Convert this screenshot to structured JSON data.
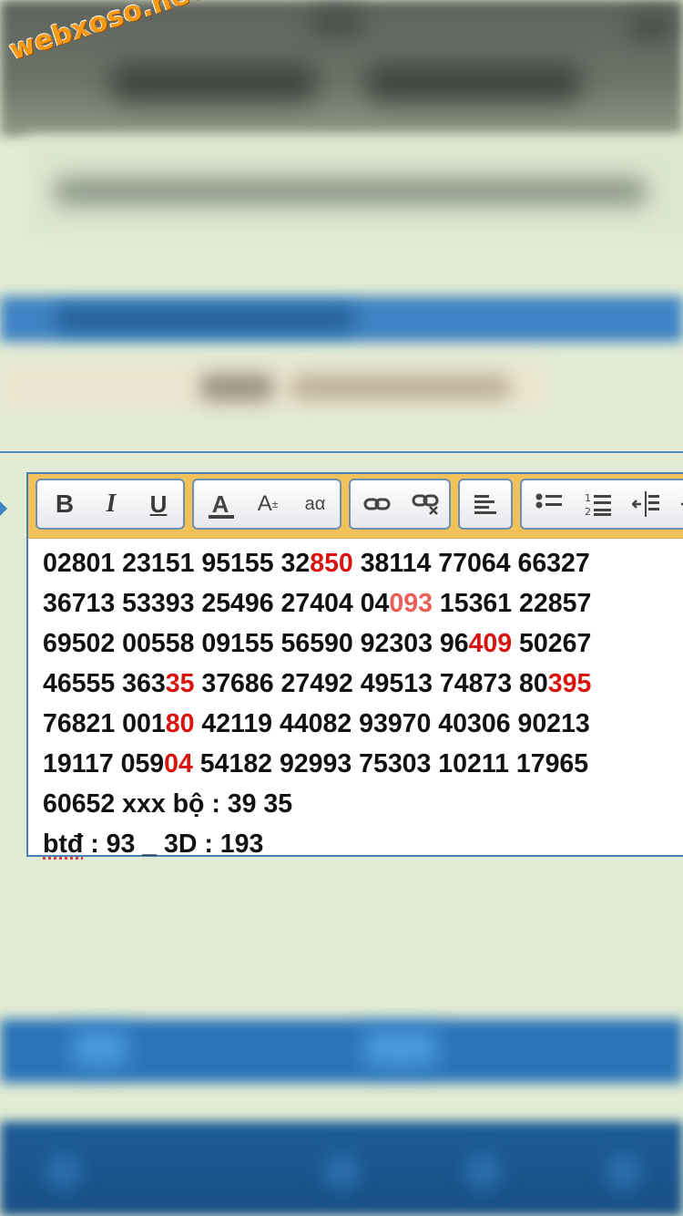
{
  "watermark": "webxoso.net",
  "toolbar": {
    "bold_label": "B",
    "italic_label": "I",
    "underline_label": "U",
    "font_color_label": "A",
    "font_size_label": "A",
    "font_size_sup": "±",
    "format_label": "aα"
  },
  "editor": {
    "lines": [
      [
        {
          "t": "02801 23151 95155 32"
        },
        {
          "t": "850",
          "c": "hl"
        },
        {
          "t": " 38114 77064 66327"
        }
      ],
      [
        {
          "t": "36713 53393 25496 27404 04"
        },
        {
          "t": "093",
          "c": "hl-light"
        },
        {
          "t": " 15361 22857"
        }
      ],
      [
        {
          "t": "69502 00558 09155 56590 92303 96"
        },
        {
          "t": "409",
          "c": "hl"
        },
        {
          "t": " 50267"
        }
      ],
      [
        {
          "t": "46555 363"
        },
        {
          "t": "35",
          "c": "hl"
        },
        {
          "t": " 37686 27492 49513 74873 80"
        },
        {
          "t": "395",
          "c": "hl"
        }
      ],
      [
        {
          "t": "76821 001"
        },
        {
          "t": "80",
          "c": "hl"
        },
        {
          "t": " 42119 44082 93970 40306 90213"
        }
      ],
      [
        {
          "t": "19117 059"
        },
        {
          "t": "04",
          "c": "hl"
        },
        {
          "t": " 54182 92993 75303 10211 17965"
        }
      ],
      [
        {
          "t": "60652 xxx bộ : 39 35"
        }
      ],
      [
        {
          "t": "btđ",
          "c": "spell"
        },
        {
          "t": " : 93 _ 3D : 193"
        }
      ]
    ]
  },
  "colors": {
    "highlight": "#d9140e",
    "highlight_light": "#e86058",
    "toolbar_bg": "#f2c25a",
    "frame_border": "#4a7fb5",
    "watermark": "#f59a16"
  }
}
